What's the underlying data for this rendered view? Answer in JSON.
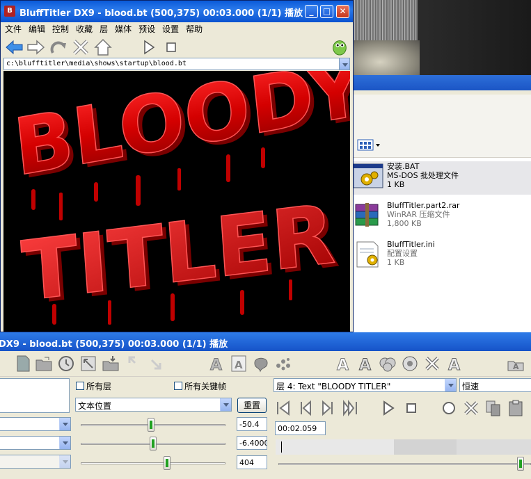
{
  "main_window": {
    "title": "BluffTitler DX9 - blood.bt (500,375) 00:03.000 (1/1)  播放",
    "menu": [
      "文件",
      "编辑",
      "控制",
      "收藏",
      "层",
      "媒体",
      "预设",
      "设置",
      "帮助"
    ],
    "address": "c:\\blufftitler\\media\\shows\\startup\\blood.bt",
    "preview_line1": "BLOODY",
    "preview_line2": "TITLER"
  },
  "explorer": {
    "files": [
      {
        "name": "安装.BAT",
        "type": "MS-DOS 批处理文件",
        "size": "1 KB",
        "icon": "batch-file-icon"
      },
      {
        "name": "BluffTitler.part2.rar",
        "type": "WinRAR 压缩文件",
        "size": "1,800 KB",
        "icon": "rar-archive-icon"
      },
      {
        "name": "BluffTitler.ini",
        "type": "配置设置",
        "size": "1 KB",
        "icon": "ini-config-icon"
      }
    ]
  },
  "panel": {
    "title": "DX9 - blood.bt (500,375) 00:03.000 (1/1)  播放",
    "all_layers_label": "所有层",
    "all_keyframes_label": "所有关键帧",
    "property_select": "文本位置",
    "reset_button": "重置",
    "layer_select": "层 4: Text \"BLOODY TITLER\"",
    "speed_select": "恒速",
    "values": [
      "-50.4",
      "-6.4000'",
      "404"
    ],
    "time": "00:02.059"
  },
  "colors": {
    "title_blue": "#0a5ad9",
    "window_bg": "#ece9d8",
    "blood_red": "#d40000"
  }
}
